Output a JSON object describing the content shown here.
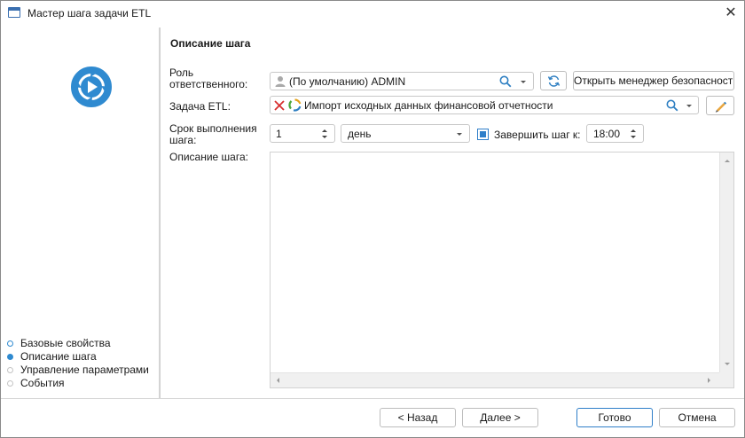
{
  "window": {
    "title": "Мастер шага задачи ETL",
    "close_glyph": "✕"
  },
  "steps": [
    {
      "label": "Базовые свойства",
      "state": "done"
    },
    {
      "label": "Описание шага",
      "state": "active"
    },
    {
      "label": "Управление параметрами",
      "state": "todo"
    },
    {
      "label": "События",
      "state": "todo"
    }
  ],
  "form": {
    "section_title": "Описание шага",
    "role_label": "Роль ответственного:",
    "role_value": "(По умолчанию) ADMIN",
    "open_security_button": "Открыть менеджер безопасности",
    "etl_label": "Задача ETL:",
    "etl_value": "Импорт исходных данных финансовой отчетности",
    "deadline_label": "Срок выполнения шага:",
    "deadline_value": "1",
    "deadline_unit": "день",
    "complete_label": "Завершить шаг к:",
    "complete_checked": true,
    "complete_time": "18:00",
    "description_label": "Описание шага:",
    "description_value": ""
  },
  "footer": {
    "back": "< Назад",
    "next": "Далее >",
    "finish": "Готово",
    "cancel": "Отмена"
  },
  "colors": {
    "accent": "#2f8ad0",
    "primary_border": "#2f7fc9"
  }
}
